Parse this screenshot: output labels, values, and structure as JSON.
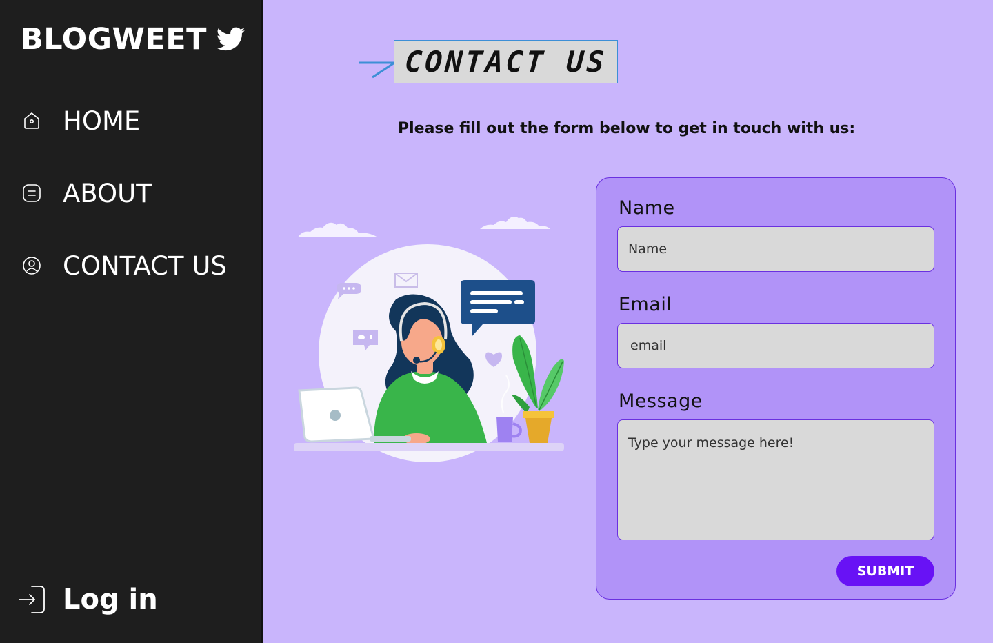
{
  "sidebar": {
    "brand": "BLOGWEET",
    "brand_icon": "twitter-bird-icon",
    "items": [
      {
        "label": "HOME",
        "icon": "home-icon"
      },
      {
        "label": "ABOUT",
        "icon": "document-icon"
      },
      {
        "label": "CONTACT US",
        "icon": "user-circle-icon"
      }
    ],
    "login": {
      "label": "Log in",
      "icon": "login-icon"
    }
  },
  "main": {
    "title": "CONTACT US",
    "subtitle": "Please fill out the form below to get in touch with us:",
    "illustration": "customer-support-illustration"
  },
  "form": {
    "name_label": "Name",
    "name_placeholder": "Name",
    "email_label": "Email",
    "email_placeholder": "email",
    "message_label": "Message",
    "message_placeholder": "Type your message here!",
    "submit_label": "SUBMIT"
  },
  "colors": {
    "background": "#c9b5fc",
    "sidebar": "#1e1e1e",
    "form_card": "#b193f8",
    "input_bg": "#d9d9d9",
    "accent": "#6812f5"
  }
}
